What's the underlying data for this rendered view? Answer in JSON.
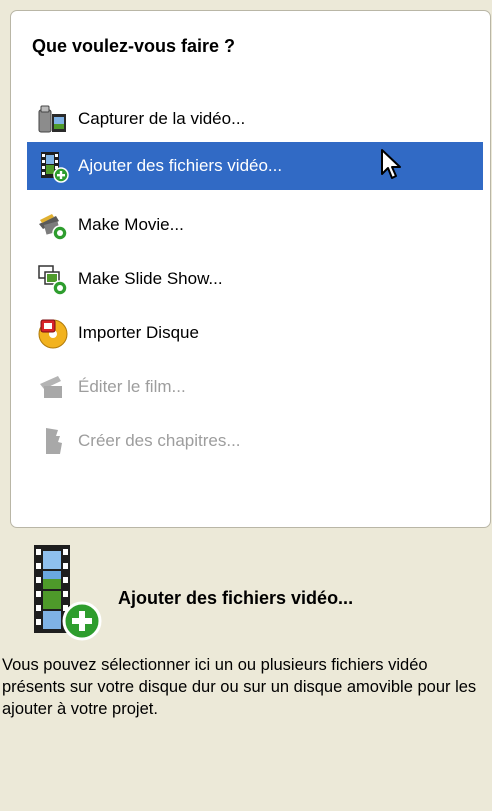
{
  "panel": {
    "title": "Que voulez-vous faire ?",
    "tasks": [
      {
        "label": "Capturer de la vidéo...",
        "icon": "camera-icon",
        "state": "normal"
      },
      {
        "label": "Ajouter des fichiers vidéo...",
        "icon": "film-add-icon",
        "state": "selected"
      },
      {
        "label": "Make Movie...",
        "icon": "make-movie-icon",
        "state": "normal"
      },
      {
        "label": "Make Slide Show...",
        "icon": "slideshow-icon",
        "state": "normal"
      },
      {
        "label": "Importer Disque",
        "icon": "disc-icon",
        "state": "normal"
      },
      {
        "label": "Éditer le film...",
        "icon": "edit-film-icon",
        "state": "disabled"
      },
      {
        "label": "Créer des chapitres...",
        "icon": "chapters-icon",
        "state": "disabled"
      }
    ]
  },
  "detail": {
    "title": "Ajouter des fichiers vidéo...",
    "description": "Vous pouvez sélectionner ici un ou plusieurs fichiers vidéo présents sur votre disque dur ou sur un disque amovible pour les ajouter à votre projet."
  },
  "colors": {
    "background": "#ece9d8",
    "selection": "#316ac5",
    "disabled_text": "#9d9d9d"
  }
}
